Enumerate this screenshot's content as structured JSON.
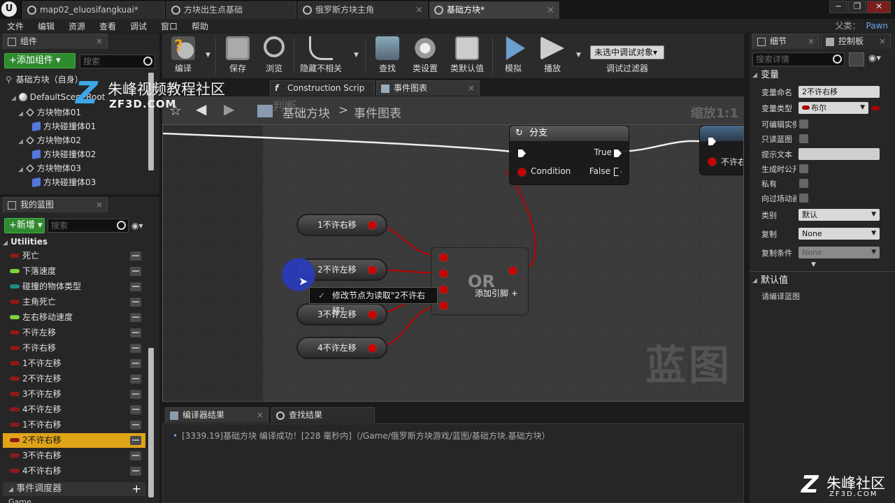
{
  "window": {
    "tabs": [
      {
        "label": "map02_eluosifangkuai*"
      },
      {
        "label": "方块出生点基础"
      },
      {
        "label": "俄罗斯方块主角"
      },
      {
        "label": "基础方块*"
      }
    ],
    "buttons": {
      "minimize": "─",
      "restore": "❐",
      "close": "✕"
    }
  },
  "menubar": {
    "items": [
      "文件",
      "编辑",
      "资源",
      "查看",
      "调试",
      "窗口",
      "帮助"
    ],
    "parent_label": "父类：",
    "parent_value": "Pawn"
  },
  "components": {
    "tab_label": "组件",
    "add_button": "+添加组件 ▾",
    "search_placeholder": "搜索",
    "self_label": "基础方块（自身）",
    "tree": [
      {
        "label": "DefaultSceneRoot"
      },
      {
        "label": "方块物体01"
      },
      {
        "label": "方块碰撞体01"
      },
      {
        "label": "方块物体02"
      },
      {
        "label": "方块碰撞体02"
      },
      {
        "label": "方块物体03"
      },
      {
        "label": "方块碰撞体03"
      }
    ]
  },
  "my_blueprint": {
    "tab_label": "我的蓝图",
    "new_button": "+新增 ▾",
    "search_placeholder": "搜索",
    "category": "Utilities",
    "variables": [
      {
        "label": "死亡",
        "color": "#8b1a1a"
      },
      {
        "label": "下落速度",
        "color": "#7fd13b"
      },
      {
        "label": "碰撞的物体类型",
        "color": "#1e8c86"
      },
      {
        "label": "主角死亡",
        "color": "#8b1a1a"
      },
      {
        "label": "左右移动速度",
        "color": "#7fd13b"
      },
      {
        "label": "不许左移",
        "color": "#8b1a1a"
      },
      {
        "label": "不许右移",
        "color": "#8b1a1a"
      },
      {
        "label": "1不许左移",
        "color": "#8b1a1a"
      },
      {
        "label": "2不许左移",
        "color": "#8b1a1a"
      },
      {
        "label": "3不许左移",
        "color": "#8b1a1a"
      },
      {
        "label": "4不许左移",
        "color": "#8b1a1a"
      },
      {
        "label": "1不许右移",
        "color": "#8b1a1a"
      },
      {
        "label": "2不许右移",
        "color": "#8b1a1a",
        "selected": true
      },
      {
        "label": "3不许右移",
        "color": "#8b1a1a"
      },
      {
        "label": "4不许右移",
        "color": "#8b1a1a"
      }
    ],
    "event_dispatchers": "事件调度器",
    "next_category": "Game"
  },
  "toolbar": {
    "compile": "编译",
    "save": "保存",
    "browse": "浏览",
    "hide_unrelated": "隐藏不相关",
    "find": "查找",
    "class_settings": "类设置",
    "class_defaults": "类默认值",
    "simulate": "模拟",
    "play": "播放",
    "debug_object": "未选中调试对象▾",
    "debug_filter": "调试过滤器"
  },
  "graph_tabs": {
    "construction": "Construction Scrip",
    "event_graph": "事件图表"
  },
  "graph_header": {
    "breadcrumb_root": "基础方块",
    "breadcrumb_sep": ">",
    "breadcrumb_leaf": "事件图表",
    "zoom": "缩放1:1",
    "comment_partial": "判断"
  },
  "graph": {
    "branch": {
      "title": "分支",
      "true_label": "True",
      "condition_label": "Condition",
      "false_label": "False"
    },
    "right_node_text": "不许右",
    "getters": [
      "1不许右移",
      "2不许左移",
      "3不许左移",
      "4不许左移"
    ],
    "or_node": {
      "title": "OR",
      "add_pin": "添加引脚 +"
    },
    "tooltip": "修改节点为读取\"2不许右移\"",
    "watermark": "蓝图"
  },
  "bottom": {
    "tabs": [
      "编译器结果",
      "查找结果"
    ],
    "log": "[3339.19]基础方块 编译成功！[228 毫秒内]（/Game/俄罗斯方块游戏/蓝图/基础方块.基础方块）"
  },
  "details": {
    "tabs": [
      "细节",
      "控制板"
    ],
    "search_placeholder": "搜索详情",
    "section_variable": "变量",
    "rows": {
      "var_name_label": "变量命名",
      "var_name_value": "2不许右移",
      "var_type_label": "变量类型",
      "var_type_value": "布尔",
      "editable_label": "可编辑实例",
      "readonly_label": "只读蓝图",
      "tooltip_label": "提示文本",
      "expose_spawn_label": "生成时公开",
      "private_label": "私有",
      "cinematic_label": "向过场动画公开",
      "category_label": "类别",
      "category_value": "默认",
      "replication_label": "复制",
      "replication_value": "None",
      "repcond_label": "复制条件",
      "repcond_value": "None"
    },
    "section_default": "默认值",
    "default_hint": "请编译蓝图"
  },
  "site_watermark": {
    "top_text": "朱峰视频教程社区",
    "top_sub": "ZF3D.COM",
    "bottom_text": "朱峰社区",
    "bottom_sub": "ZF3D.COM",
    "logo_letter": "Z"
  },
  "colors": {
    "accent": "#e0a419",
    "bool_pin": "#cc0000",
    "green_button": "#2f8b2f"
  }
}
